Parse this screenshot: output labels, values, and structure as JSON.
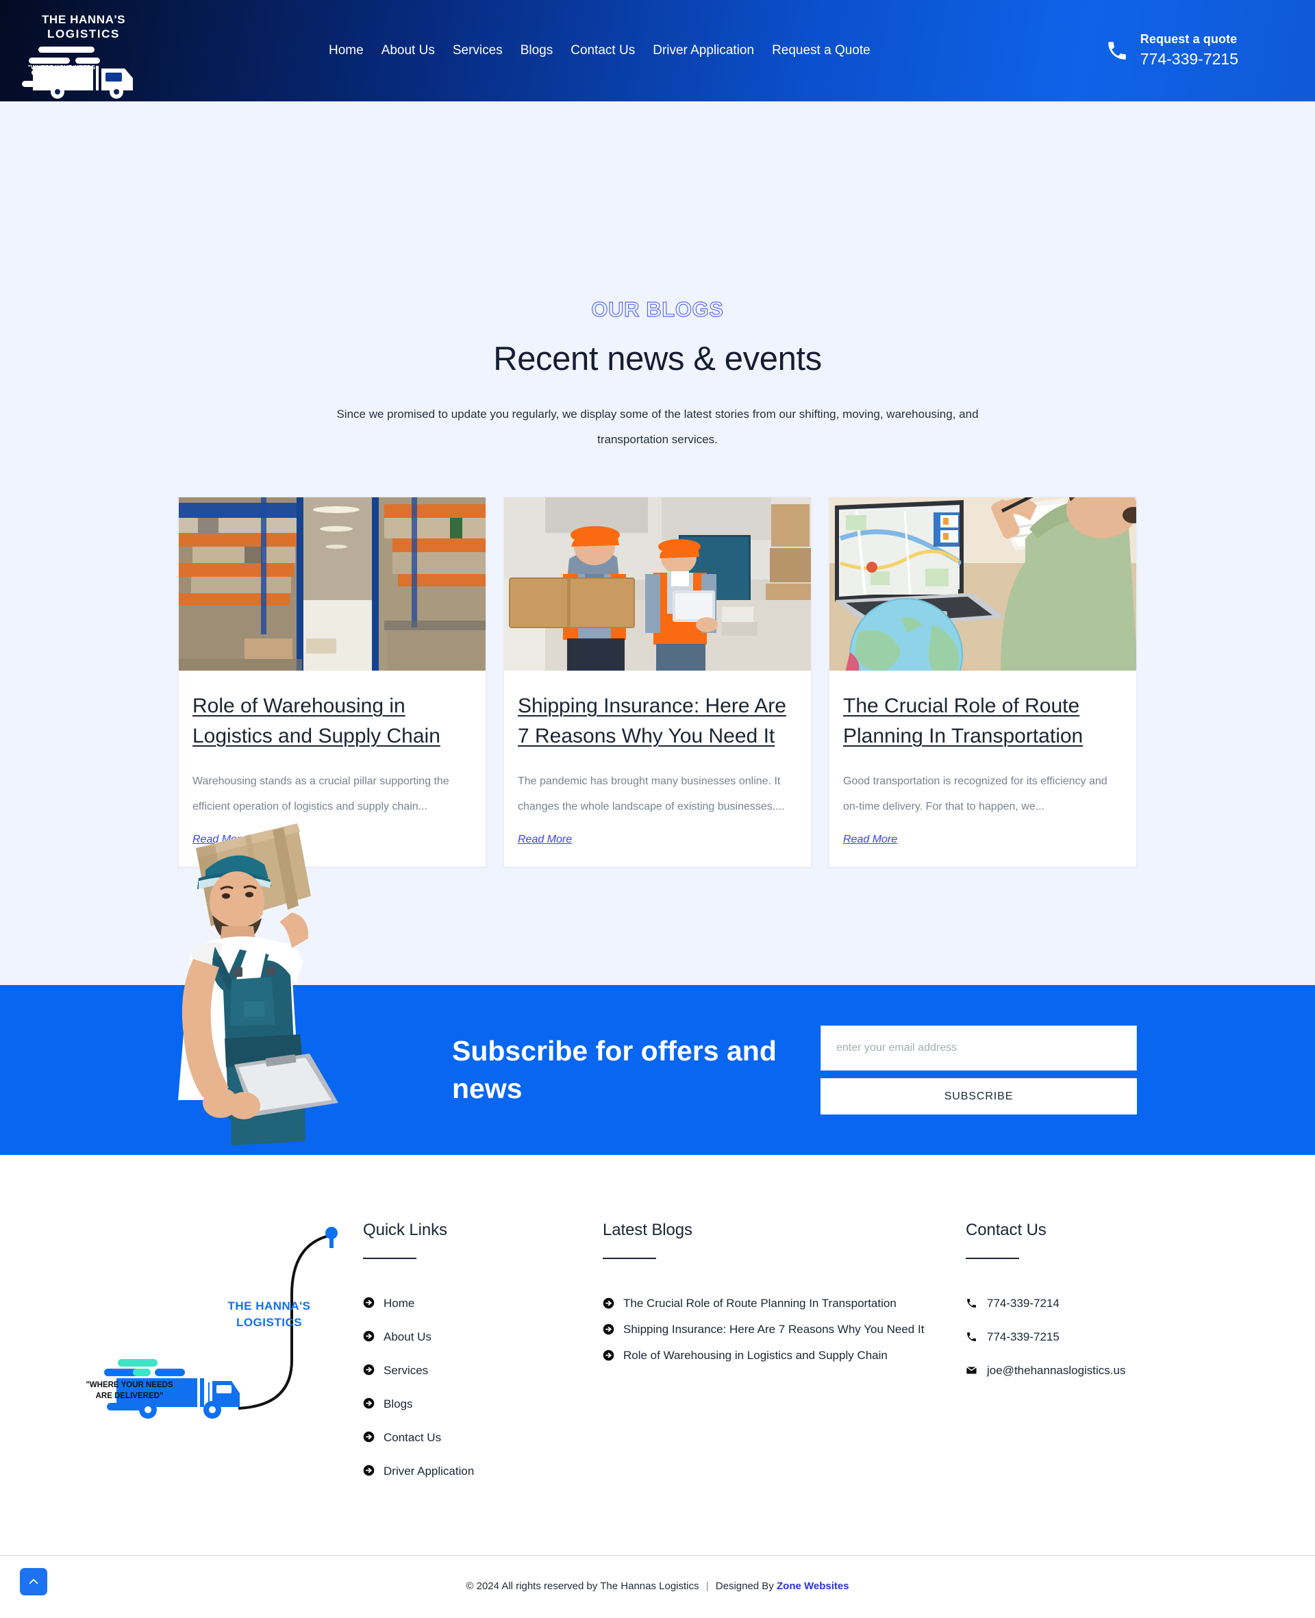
{
  "header": {
    "logo": {
      "line1": "THE HANNA'S",
      "line2": "LOGISTICS",
      "tagline": "\"WHERE YOUR NEEDS ARE DELIVERED\"",
      "tagline_l1": "\"WHERE YOUR NEEDS",
      "tagline_l2": "ARE DELIVERED\""
    },
    "nav": [
      {
        "label": "Home"
      },
      {
        "label": "About Us"
      },
      {
        "label": "Services"
      },
      {
        "label": "Blogs"
      },
      {
        "label": "Contact Us"
      },
      {
        "label": "Driver Application"
      },
      {
        "label": "Request a Quote"
      }
    ],
    "quote": {
      "label": "Request a quote",
      "phone": "774-339-7215",
      "icon": "phone-icon"
    }
  },
  "blogs_section": {
    "eyebrow": "OUR BLOGS",
    "title": "Recent news & events",
    "subtitle": "Since we promised to update you regularly, we display some of the latest stories from our shifting, moving, warehousing, and transportation services.",
    "cards": [
      {
        "title": "Role of Warehousing in Logistics and Supply Chain",
        "excerpt": "Warehousing stands as a crucial pillar supporting the efficient operation of logistics and supply chain...",
        "read_more": "Read More",
        "image_alt": "warehouse-aisle-with-pallet-racking"
      },
      {
        "title": "Shipping Insurance: Here Are 7 Reasons Why You Need It",
        "excerpt": "The pandemic has brought many businesses online. It changes the whole landscape of existing businesses....",
        "read_more": "Read More",
        "image_alt": "two-warehouse-workers-with-box-and-tablet"
      },
      {
        "title": "The Crucial Role of Route Planning In Transportation",
        "excerpt": "Good transportation is recognized for its efficiency and on-time delivery. For that to happen, we...",
        "read_more": "Read More",
        "image_alt": "person-at-laptop-with-route-map-and-globe"
      }
    ]
  },
  "subscribe": {
    "title": "Subscribe for offers and news",
    "email_placeholder": "enter your email address",
    "email_value": "",
    "button_label": "SUBSCRIBE",
    "worker_image_alt": "delivery-worker-carrying-box-with-clipboard"
  },
  "footer": {
    "logo": {
      "line1": "THE HANNA'S",
      "line2": "LOGISTICS",
      "tagline_l1": "\"WHERE YOUR NEEDS",
      "tagline_l2": "ARE DELIVERED\""
    },
    "quick_links": {
      "heading": "Quick Links",
      "items": [
        {
          "label": "Home"
        },
        {
          "label": "About Us"
        },
        {
          "label": "Services"
        },
        {
          "label": "Blogs"
        },
        {
          "label": "Contact Us"
        },
        {
          "label": "Driver Application"
        }
      ]
    },
    "latest_blogs": {
      "heading": "Latest Blogs",
      "items": [
        {
          "label": "The Crucial Role of Route Planning In Transportation"
        },
        {
          "label": "Shipping Insurance: Here Are 7 Reasons Why You Need It"
        },
        {
          "label": "Role of Warehousing in Logistics and Supply Chain"
        }
      ]
    },
    "contact": {
      "heading": "Contact Us",
      "items": [
        {
          "icon": "phone-icon",
          "label": "774-339-7214"
        },
        {
          "icon": "phone-icon",
          "label": "774-339-7215"
        },
        {
          "icon": "envelope-icon",
          "label": "joe@thehannaslogistics.us"
        }
      ]
    },
    "bottom": {
      "copyright": "© 2024 All rights reserved by The Hannas Logistics",
      "separator": "|",
      "designed_by": "Designed By",
      "designer_link": "Zone Websites"
    },
    "to_top_icon": "chevron-up-icon"
  },
  "colors": {
    "brand_blue": "#0866f0",
    "header_dark": "#030b22",
    "page_bg": "#f0f4fe",
    "link_blue": "#2a33d8",
    "eyebrow_outline": "#5c6ff0"
  }
}
